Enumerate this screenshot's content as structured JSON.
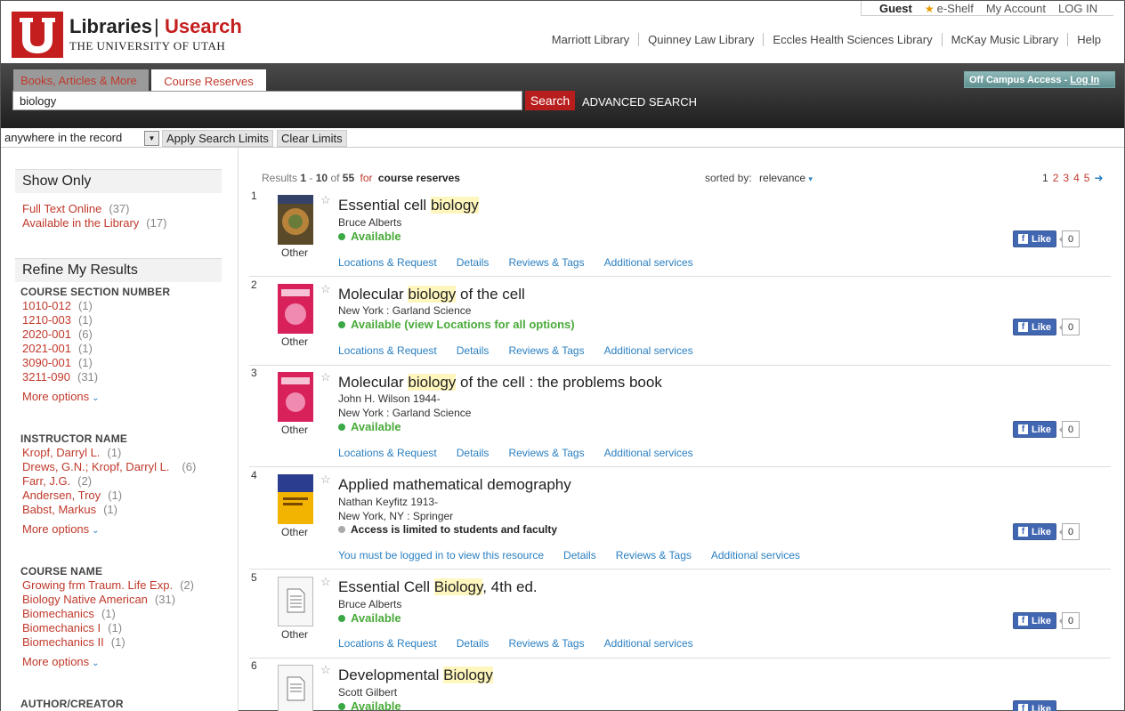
{
  "brand": {
    "libraries": "Libraries",
    "separator": "|",
    "usearch": "Usearch",
    "university": "THE UNIVERSITY OF UTAH"
  },
  "topbar": {
    "guest": "Guest",
    "eshelf": "e-Shelf",
    "account": "My Account",
    "login": "LOG IN"
  },
  "libnav": [
    "Marriott Library",
    "Quinney Law Library",
    "Eccles Health Sciences Library",
    "McKay Music Library",
    "Help"
  ],
  "search": {
    "tab_books": "Books, Articles & More",
    "tab_reserves": "Course Reserves",
    "query": "biology",
    "button": "Search",
    "advanced": "ADVANCED SEARCH",
    "offcampus": "Off Campus Access -",
    "offcampus_login": "Log In"
  },
  "limits": {
    "scope": "anywhere in the record",
    "apply": "Apply Search Limits",
    "clear": "Clear Limits"
  },
  "sidebar": {
    "show_only_title": "Show Only",
    "show_only": [
      {
        "label": "Full Text Online",
        "count": "(37)"
      },
      {
        "label": "Available in the Library",
        "count": "(17)"
      }
    ],
    "refine_title": "Refine My Results",
    "course_section_head": "COURSE SECTION NUMBER",
    "course_sections": [
      {
        "label": "1010-012",
        "count": "(1)"
      },
      {
        "label": "1210-003",
        "count": "(1)"
      },
      {
        "label": "2020-001",
        "count": "(6)"
      },
      {
        "label": "2021-001",
        "count": "(1)"
      },
      {
        "label": "3090-001",
        "count": "(1)"
      },
      {
        "label": "3211-090",
        "count": "(31)"
      }
    ],
    "more_options": "More options",
    "instructor_head": "INSTRUCTOR NAME",
    "instructors": [
      {
        "label": "Kropf, Darryl L.",
        "count": "(1)"
      },
      {
        "label": "Drews, G.N.; Kropf, Darryl L.",
        "count": "(6)"
      },
      {
        "label": "Farr, J.G.",
        "count": "(2)"
      },
      {
        "label": "Andersen, Troy",
        "count": "(1)"
      },
      {
        "label": "Babst, Markus",
        "count": "(1)"
      }
    ],
    "course_name_head": "COURSE NAME",
    "course_names": [
      {
        "label": "Growing frm Traum. Life Exp.",
        "count": "(2)"
      },
      {
        "label": "Biology Native American",
        "count": "(31)"
      },
      {
        "label": "Biomechanics",
        "count": "(1)"
      },
      {
        "label": "Biomechanics I",
        "count": "(1)"
      },
      {
        "label": "Biomechanics II",
        "count": "(1)"
      }
    ],
    "author_head": "AUTHOR/CREATOR"
  },
  "results_head": {
    "prefix": "Results",
    "start": "1",
    "dash": "-",
    "end": "10",
    "of": "of",
    "total": "55",
    "for": "for",
    "query": "course reserves"
  },
  "sorted": {
    "label": "sorted by:",
    "value": "relevance"
  },
  "pager": {
    "current": "1",
    "pages": [
      "2",
      "3",
      "4",
      "5"
    ]
  },
  "results": [
    {
      "num": "1",
      "title_pre": "Essential cell ",
      "title_hl": "biology",
      "title_post": "",
      "line1": "Bruce Alberts",
      "line2": "",
      "avail": "Available",
      "type": "Other",
      "actions": [
        "Locations & Request",
        "Details",
        "Reviews & Tags",
        "Additional services"
      ],
      "like": "Like",
      "like_count": "0"
    },
    {
      "num": "2",
      "title_pre": "Molecular ",
      "title_hl": "biology",
      "title_post": " of the cell",
      "line1": "New York : Garland Science",
      "line2": "",
      "avail": "Available (view Locations for all options)",
      "type": "Other",
      "actions": [
        "Locations & Request",
        "Details",
        "Reviews & Tags",
        "Additional services"
      ],
      "like": "Like",
      "like_count": "0"
    },
    {
      "num": "3",
      "title_pre": "Molecular ",
      "title_hl": "biology",
      "title_post": " of the cell : the problems book",
      "line1": "John H. Wilson 1944-",
      "line2": "New York : Garland Science",
      "avail": "Available",
      "type": "Other",
      "actions": [
        "Locations & Request",
        "Details",
        "Reviews & Tags",
        "Additional services"
      ],
      "like": "Like",
      "like_count": "0"
    },
    {
      "num": "4",
      "title_pre": "Applied mathematical demography",
      "title_hl": "",
      "title_post": "",
      "line1": "Nathan Keyfitz 1913-",
      "line2": "New York, NY : Springer",
      "avail": "Access is limited to students and faculty",
      "type": "Other",
      "actions": [
        "You must be logged in to view this resource",
        "Details",
        "Reviews & Tags",
        "Additional services"
      ],
      "like": "Like",
      "like_count": "0"
    },
    {
      "num": "5",
      "title_pre": "Essential Cell ",
      "title_hl": "Biology",
      "title_post": ", 4th ed.",
      "line1": "Bruce Alberts",
      "line2": "",
      "avail": "Available",
      "type": "Other",
      "actions": [
        "Locations & Request",
        "Details",
        "Reviews & Tags",
        "Additional services"
      ],
      "like": "Like",
      "like_count": "0"
    },
    {
      "num": "6",
      "title_pre": "Developmental ",
      "title_hl": "Biology",
      "title_post": "",
      "line1": "Scott Gilbert",
      "line2": "",
      "avail": "Available",
      "type": "",
      "actions": [],
      "like": "Like",
      "like_count": ""
    }
  ],
  "colors": {
    "brand_red": "#c41e1e",
    "link_red": "#c0392b",
    "link_blue": "#2a7fc1",
    "available_green": "#4aaa3a",
    "highlight": "#fff6bd"
  }
}
